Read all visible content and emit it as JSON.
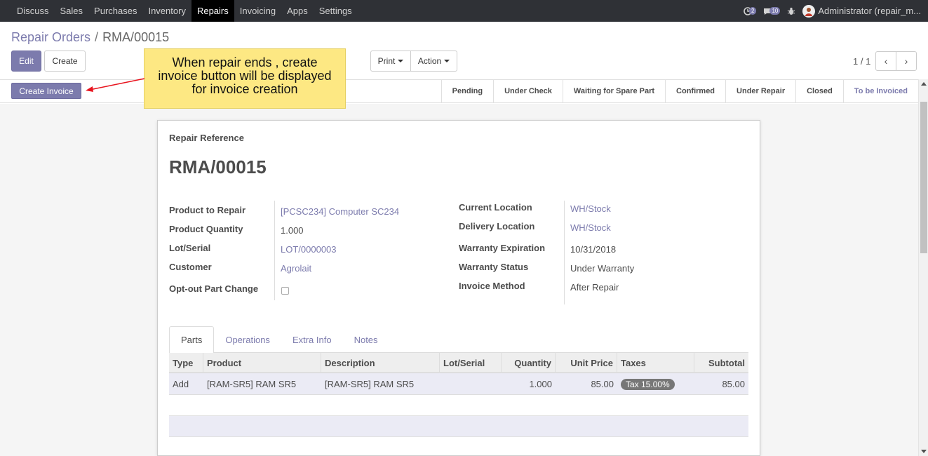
{
  "navbar": {
    "menu": [
      "Discuss",
      "Sales",
      "Purchases",
      "Inventory",
      "Repairs",
      "Invoicing",
      "Apps",
      "Settings"
    ],
    "active_index": 4,
    "activity_count": "2",
    "message_count": "10",
    "user": "Administrator (repair_m..."
  },
  "breadcrumb": {
    "parent": "Repair Orders",
    "separator": "/",
    "current": "RMA/00015"
  },
  "buttons": {
    "edit": "Edit",
    "create": "Create",
    "print": "Print",
    "action": "Action",
    "create_invoice": "Create Invoice"
  },
  "pager": {
    "value": "1 / 1"
  },
  "statusbar": {
    "stages": [
      "Pending",
      "Under Check",
      "Waiting for Spare Part",
      "Confirmed",
      "Under Repair",
      "Closed",
      "To be Invoiced"
    ],
    "current_index": 6
  },
  "callout": {
    "lines": [
      "When repair ends , create",
      "invoice button will be displayed",
      "for invoice creation"
    ]
  },
  "form": {
    "ref_label": "Repair Reference",
    "name": "RMA/00015",
    "left": {
      "product_label": "Product to Repair",
      "product_value": "[PCSC234] Computer SC234",
      "qty_label": "Product Quantity",
      "qty_value": "1.000",
      "lot_label": "Lot/Serial",
      "lot_value": "LOT/0000003",
      "customer_label": "Customer",
      "customer_value": "Agrolait",
      "optout_label": "Opt-out Part Change"
    },
    "right": {
      "curloc_label": "Current Location",
      "curloc_value": "WH/Stock",
      "delloc_label": "Delivery Location",
      "delloc_value": "WH/Stock",
      "warexp_label": "Warranty Expiration",
      "warexp_value": "10/31/2018",
      "warstat_label": "Warranty Status",
      "warstat_value": "Under Warranty",
      "invmethod_label": "Invoice Method",
      "invmethod_value": "After Repair"
    }
  },
  "tabs": [
    "Parts",
    "Operations",
    "Extra Info",
    "Notes"
  ],
  "table": {
    "columns": [
      "Type",
      "Product",
      "Description",
      "Lot/Serial",
      "Quantity",
      "Unit Price",
      "Taxes",
      "Subtotal"
    ],
    "rows": [
      {
        "type": "Add",
        "product": "[RAM-SR5] RAM SR5",
        "description": "[RAM-SR5] RAM SR5",
        "lot": "",
        "quantity": "1.000",
        "unit_price": "85.00",
        "taxes": "Tax 15.00%",
        "subtotal": "85.00"
      }
    ]
  },
  "colors": {
    "brand": "#7c7bad",
    "navbar": "#2f3136",
    "callout": "#fde883",
    "arrow": "#e8141e"
  }
}
